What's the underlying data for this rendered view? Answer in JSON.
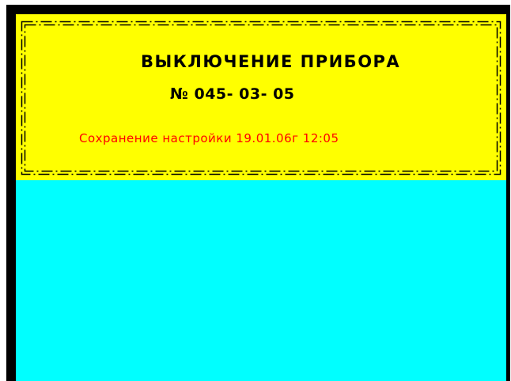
{
  "panel": {
    "title": "ВЫКЛЮЧЕНИЕ ПРИБОРА",
    "device_number": "№ 045- 03- 05",
    "save_info": "Сохранение настройки 19.01.06г 12:05"
  },
  "colors": {
    "frame": "#000000",
    "display_background": "#00ffff",
    "panel_background": "#ffff00",
    "title_text": "#000000",
    "save_info_text": "#ff0000"
  }
}
